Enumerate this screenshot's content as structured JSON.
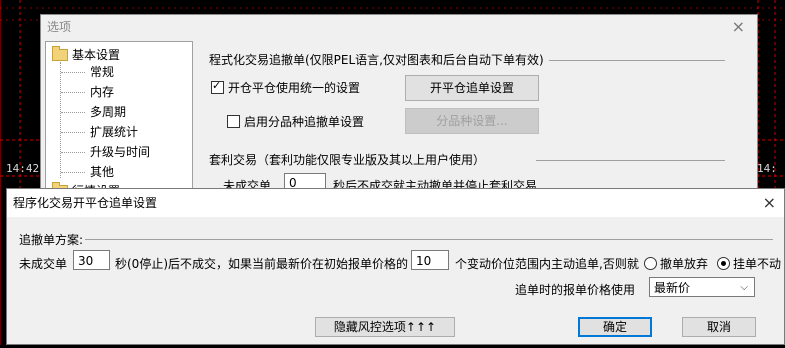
{
  "background": {
    "time_tags": [
      "14:42",
      "14:",
      "14:",
      "14:"
    ]
  },
  "options_dialog": {
    "title": "选项",
    "close_icon": "×",
    "tree": {
      "root_label": "基本设置",
      "items": [
        "常规",
        "内存",
        "多周期",
        "扩展统计",
        "升级与时间",
        "其他"
      ],
      "next_root_label": "行情设置"
    },
    "order_section": {
      "header": "程式化交易追撤单(仅限PEL语言,仅对图表和后台自动下单有效)",
      "unified_label": "开仓平仓使用统一的设置",
      "unified_checked": true,
      "open_close_button": "开平仓追单设置",
      "per_variety_label": "启用分品种追撤单设置",
      "per_variety_checked": false,
      "per_variety_button": "分品种设置..."
    },
    "arbitrage_section": {
      "header": "套利交易（套利功能仅限专业版及其以上用户使用）",
      "unfilled_prefix": "未成交单",
      "unfilled_value": "0",
      "unfilled_suffix": "秒后不成交就主动撤单并停止套利交易"
    }
  },
  "main_dialog": {
    "title": "程序化交易开平仓追单设置",
    "close_icon": "×",
    "plan_label": "追撤单方案:",
    "row": {
      "prefix": "未成交单",
      "seconds_value": "30",
      "middle": "秒(0停止)后不成交，如果当前最新价在初始报单价格的",
      "ticks_value": "10",
      "suffix": "个变动价位范围内主动追单,否则就",
      "radio_cancel": "撤单放弃",
      "radio_hang": "挂单不动",
      "selected": "挂单不动"
    },
    "price_label": "追单时的报单价格使用",
    "price_select": "最新价",
    "hide_risk_button": "隐藏风控选项↑↑↑",
    "ok_button": "确定",
    "cancel_button": "取消"
  }
}
